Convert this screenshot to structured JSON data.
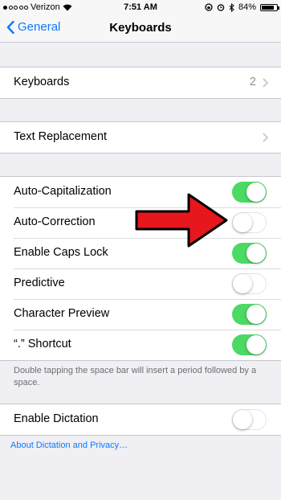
{
  "status_bar": {
    "carrier": "Verizon",
    "time": "7:51 AM",
    "battery_percent": "84%"
  },
  "nav": {
    "back_label": "General",
    "title": "Keyboards"
  },
  "keyboards_row": {
    "label": "Keyboards",
    "count": "2"
  },
  "text_replacement_row": {
    "label": "Text Replacement"
  },
  "settings": [
    {
      "label": "Auto-Capitalization",
      "on": true
    },
    {
      "label": "Auto-Correction",
      "on": false
    },
    {
      "label": "Enable Caps Lock",
      "on": true
    },
    {
      "label": "Predictive",
      "on": false
    },
    {
      "label": "Character Preview",
      "on": true
    },
    {
      "label": "“.” Shortcut",
      "on": true
    }
  ],
  "shortcut_footer": "Double tapping the space bar will insert a period followed by a space.",
  "dictation": {
    "label": "Enable Dictation",
    "on": false
  },
  "dictation_link": "About Dictation and Privacy…",
  "colors": {
    "accent": "#0a7aff",
    "toggle_on": "#4cd964",
    "arrow": "#e8161d"
  }
}
